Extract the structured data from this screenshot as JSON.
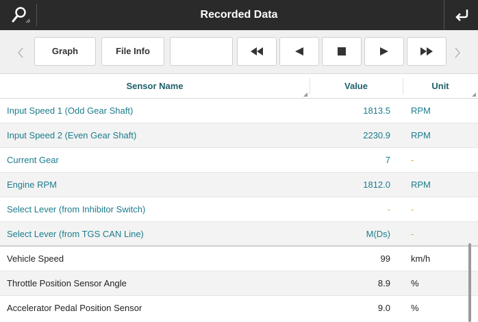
{
  "header": {
    "title": "Recorded Data",
    "left_icon": "search-icon",
    "right_icon": "back-arrow-icon"
  },
  "toolbar": {
    "graph_label": "Graph",
    "file_info_label": "File Info",
    "blank_label": "",
    "controls": [
      "rewind-icon",
      "play-reverse-icon",
      "stop-icon",
      "play-icon",
      "fast-forward-icon"
    ]
  },
  "table": {
    "columns": {
      "name": "Sensor Name",
      "value": "Value",
      "unit": "Unit"
    },
    "rows": [
      {
        "name": "Input Speed 1 (Odd Gear Shaft)",
        "value": "1813.5",
        "unit": "RPM"
      },
      {
        "name": "Input Speed 2 (Even Gear Shaft)",
        "value": "2230.9",
        "unit": "RPM"
      },
      {
        "name": "Current Gear",
        "value": "7",
        "unit": "-"
      },
      {
        "name": "Engine RPM",
        "value": "1812.0",
        "unit": "RPM"
      },
      {
        "name": "Select Lever (from Inhibitor Switch)",
        "value": "-",
        "unit": "-"
      },
      {
        "name": "Select Lever (from TGS CAN Line)",
        "value": "M(Ds)",
        "unit": "-"
      },
      {
        "name": "Vehicle Speed",
        "value": "99",
        "unit": "km/h"
      },
      {
        "name": "Throttle Position Sensor Angle",
        "value": "8.9",
        "unit": "%"
      },
      {
        "name": "Accelerator Pedal Position Sensor",
        "value": "9.0",
        "unit": "%"
      }
    ]
  },
  "colors": {
    "titlebar": "#2a2a2a",
    "accent_teal": "#1b7c8c",
    "header_teal": "#1f5f6a"
  }
}
